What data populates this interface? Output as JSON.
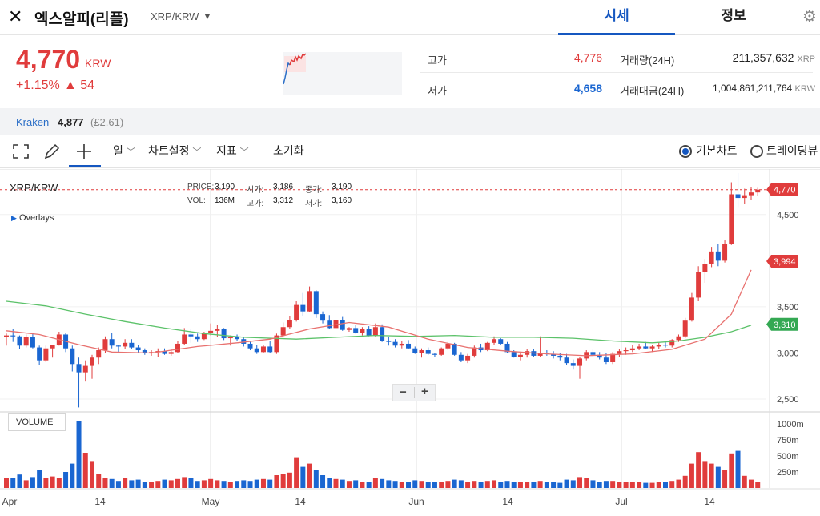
{
  "header": {
    "logo_glyph": "✕",
    "coin_name": "엑스알피(리플)",
    "pair": "XRP/KRW",
    "tabs": [
      {
        "label": "시세"
      },
      {
        "label": "정보"
      }
    ]
  },
  "summary": {
    "price": "4,770",
    "price_unit": "KRW",
    "change_pct": "+1.15%",
    "change_abs": "▲ 54",
    "high_label": "고가",
    "high_value": "4,776",
    "low_label": "저가",
    "low_value": "4,658",
    "volume_label": "거래량(24H)",
    "volume_value": "211,357,632",
    "volume_unit": "XRP",
    "amount_label": "거래대금(24H)",
    "amount_value": "1,004,861,211,764",
    "amount_unit": "KRW"
  },
  "exchange": {
    "name": "Kraken",
    "price": "4,877",
    "change": "(£2.61)"
  },
  "toolbar": {
    "period": "일",
    "chart_settings": "차트설정",
    "indicators": "지표",
    "reset": "초기화",
    "basic_chart": "기본차트",
    "trading_view": "트레이딩뷰"
  },
  "chart_info": {
    "symbol": "XRP/KRW",
    "price_label": "PRICE:",
    "price_value": "3,190",
    "open_label": "시가:",
    "open_value": "3,186",
    "close_label": "종가:",
    "close_value": "3,190",
    "vol_label": "VOL:",
    "vol_value": "136M",
    "high_label": "고가:",
    "high_value": "3,312",
    "low_label": "저가:",
    "low_value": "3,160",
    "overlays": "Overlays",
    "volume_panel": "VOLUME",
    "zoom_out": "−",
    "zoom_in": "+"
  },
  "colors": {
    "up": "#e03c3c",
    "down": "#1a66d1",
    "ma_fast": "#e8716f",
    "ma_slow": "#5cc26a",
    "accent": "#1557c0"
  },
  "chart_data": {
    "type": "candlestick",
    "price_axis": {
      "ticks": [
        "4,500",
        "3,500",
        "3,000",
        "2,500"
      ],
      "tick_values": [
        4500,
        3500,
        3000,
        2500
      ],
      "min": 2370,
      "max": 4950
    },
    "volume_axis": {
      "ticks": [
        "1000m",
        "750m",
        "500m",
        "250m"
      ],
      "tick_values": [
        1000,
        750,
        500,
        250
      ],
      "max": 1100
    },
    "x_ticks": [
      "Apr",
      "14",
      "May",
      "14",
      "Jun",
      "14",
      "Jul",
      "14"
    ],
    "price_markers": [
      {
        "label": "4,770",
        "value": 4770,
        "color": "#e03c3c"
      },
      {
        "label": "3,994",
        "value": 3994,
        "color": "#e03c3c"
      },
      {
        "label": "3,310",
        "value": 3310,
        "color": "#34a853"
      }
    ],
    "candles": [
      [
        3170,
        3210,
        3080,
        3190,
        160
      ],
      [
        3190,
        3260,
        3120,
        3180,
        150
      ],
      [
        3180,
        3190,
        3040,
        3080,
        210
      ],
      [
        3080,
        3200,
        3060,
        3170,
        120
      ],
      [
        3170,
        3210,
        3050,
        3060,
        170
      ],
      [
        3060,
        3080,
        2870,
        2920,
        280
      ],
      [
        2920,
        3080,
        2900,
        3050,
        150
      ],
      [
        3050,
        3090,
        2950,
        3090,
        180
      ],
      [
        3090,
        3230,
        3080,
        3200,
        160
      ],
      [
        3200,
        3220,
        3010,
        3050,
        250
      ],
      [
        3050,
        3080,
        2800,
        2880,
        380
      ],
      [
        2880,
        2950,
        2410,
        2790,
        1050
      ],
      [
        2790,
        2920,
        2690,
        2860,
        550
      ],
      [
        2860,
        2980,
        2720,
        2950,
        420
      ],
      [
        2950,
        3060,
        2880,
        3030,
        220
      ],
      [
        3030,
        3180,
        3000,
        3150,
        160
      ],
      [
        3150,
        3220,
        3050,
        3080,
        140
      ],
      [
        3080,
        3090,
        3000,
        3070,
        110
      ],
      [
        3070,
        3150,
        3040,
        3110,
        150
      ],
      [
        3110,
        3150,
        3040,
        3060,
        120
      ],
      [
        3060,
        3090,
        3000,
        3030,
        130
      ],
      [
        3030,
        3050,
        2980,
        3000,
        100
      ],
      [
        3000,
        3030,
        2970,
        3010,
        90
      ],
      [
        3010,
        3050,
        2960,
        3020,
        110
      ],
      [
        3020,
        3050,
        2980,
        2990,
        130
      ],
      [
        2990,
        3040,
        2970,
        3010,
        120
      ],
      [
        3010,
        3130,
        3000,
        3100,
        140
      ],
      [
        3100,
        3270,
        3090,
        3200,
        170
      ],
      [
        3200,
        3260,
        3110,
        3180,
        150
      ],
      [
        3180,
        3210,
        3120,
        3150,
        110
      ],
      [
        3150,
        3230,
        3140,
        3220,
        120
      ],
      [
        3220,
        3320,
        3190,
        3240,
        140
      ],
      [
        3240,
        3300,
        3170,
        3260,
        120
      ],
      [
        3260,
        3270,
        3140,
        3160,
        110
      ],
      [
        3160,
        3190,
        3080,
        3170,
        100
      ],
      [
        3170,
        3200,
        3130,
        3150,
        110
      ],
      [
        3150,
        3170,
        3070,
        3100,
        120
      ],
      [
        3100,
        3120,
        3030,
        3050,
        110
      ],
      [
        3050,
        3090,
        2990,
        3010,
        130
      ],
      [
        3010,
        3090,
        3000,
        3070,
        140
      ],
      [
        3070,
        3130,
        3000,
        3010,
        130
      ],
      [
        3010,
        3210,
        2990,
        3190,
        200
      ],
      [
        3190,
        3330,
        3180,
        3280,
        220
      ],
      [
        3280,
        3400,
        3260,
        3360,
        240
      ],
      [
        3360,
        3560,
        3340,
        3520,
        480
      ],
      [
        3520,
        3650,
        3400,
        3450,
        330
      ],
      [
        3450,
        3720,
        3440,
        3670,
        380
      ],
      [
        3670,
        3680,
        3380,
        3420,
        280
      ],
      [
        3420,
        3450,
        3320,
        3350,
        200
      ],
      [
        3350,
        3410,
        3260,
        3270,
        160
      ],
      [
        3270,
        3380,
        3260,
        3360,
        140
      ],
      [
        3360,
        3390,
        3240,
        3250,
        130
      ],
      [
        3250,
        3280,
        3230,
        3270,
        110
      ],
      [
        3270,
        3300,
        3210,
        3220,
        120
      ],
      [
        3220,
        3280,
        3190,
        3260,
        100
      ],
      [
        3260,
        3290,
        3180,
        3190,
        90
      ],
      [
        3190,
        3320,
        3170,
        3280,
        150
      ],
      [
        3280,
        3310,
        3120,
        3130,
        140
      ],
      [
        3130,
        3170,
        3080,
        3120,
        120
      ],
      [
        3120,
        3150,
        3060,
        3080,
        110
      ],
      [
        3080,
        3130,
        3050,
        3100,
        100
      ],
      [
        3100,
        3140,
        3040,
        3050,
        90
      ],
      [
        3050,
        3070,
        2990,
        3000,
        120
      ],
      [
        3000,
        3050,
        2950,
        3030,
        110
      ],
      [
        3030,
        3060,
        2980,
        2990,
        100
      ],
      [
        2990,
        3000,
        2960,
        2980,
        90
      ],
      [
        2980,
        3060,
        2970,
        3050,
        100
      ],
      [
        3050,
        3120,
        3030,
        3100,
        110
      ],
      [
        3100,
        3110,
        2970,
        2980,
        130
      ],
      [
        2980,
        3010,
        2900,
        2920,
        120
      ],
      [
        2920,
        2990,
        2890,
        2970,
        100
      ],
      [
        2970,
        3080,
        2950,
        3060,
        110
      ],
      [
        3060,
        3100,
        3010,
        3030,
        100
      ],
      [
        3030,
        3120,
        3020,
        3110,
        110
      ],
      [
        3110,
        3180,
        3090,
        3150,
        120
      ],
      [
        3150,
        3160,
        3090,
        3100,
        100
      ],
      [
        3100,
        3120,
        3000,
        3010,
        110
      ],
      [
        3010,
        3030,
        2950,
        2960,
        100
      ],
      [
        2960,
        3000,
        2920,
        2980,
        90
      ],
      [
        2980,
        3040,
        2950,
        3020,
        100
      ],
      [
        3020,
        3040,
        2960,
        2970,
        100
      ],
      [
        2970,
        3180,
        2960,
        3000,
        110
      ],
      [
        3000,
        3030,
        2970,
        2990,
        100
      ],
      [
        2990,
        3020,
        2940,
        2970,
        90
      ],
      [
        2970,
        3000,
        2920,
        2950,
        80
      ],
      [
        2950,
        2990,
        2870,
        2890,
        130
      ],
      [
        2890,
        2930,
        2820,
        2860,
        120
      ],
      [
        2860,
        2960,
        2720,
        2940,
        170
      ],
      [
        2940,
        3030,
        2920,
        3010,
        160
      ],
      [
        3010,
        3040,
        2960,
        2980,
        120
      ],
      [
        2980,
        3010,
        2930,
        2950,
        100
      ],
      [
        2950,
        3000,
        2880,
        2900,
        110
      ],
      [
        2900,
        3010,
        2880,
        2990,
        110
      ],
      [
        2990,
        3040,
        2960,
        3020,
        100
      ],
      [
        3020,
        3060,
        2980,
        3030,
        90
      ],
      [
        3030,
        3090,
        3010,
        3050,
        100
      ],
      [
        3050,
        3100,
        3030,
        3070,
        90
      ],
      [
        3070,
        3120,
        3040,
        3050,
        80
      ],
      [
        3050,
        3090,
        3010,
        3070,
        80
      ],
      [
        3070,
        3110,
        3040,
        3090,
        90
      ],
      [
        3090,
        3130,
        3060,
        3080,
        90
      ],
      [
        3080,
        3150,
        3060,
        3140,
        110
      ],
      [
        3140,
        3200,
        3120,
        3180,
        130
      ],
      [
        3180,
        3380,
        3160,
        3350,
        190
      ],
      [
        3350,
        3650,
        3340,
        3600,
        380
      ],
      [
        3600,
        3940,
        3560,
        3880,
        560
      ],
      [
        3880,
        4020,
        3760,
        3960,
        420
      ],
      [
        3960,
        4150,
        3930,
        4100,
        380
      ],
      [
        4100,
        4180,
        3940,
        4000,
        330
      ],
      [
        4000,
        4220,
        3980,
        4180,
        280
      ],
      [
        4180,
        4850,
        4170,
        4720,
        540
      ],
      [
        4720,
        4950,
        4580,
        4680,
        580
      ],
      [
        4680,
        4780,
        4620,
        4710,
        190
      ],
      [
        4710,
        4800,
        4660,
        4740,
        130
      ],
      [
        4740,
        4790,
        4700,
        4770,
        90
      ]
    ],
    "ma_fast": [
      [
        0,
        3240
      ],
      [
        5,
        3200
      ],
      [
        11,
        3090
      ],
      [
        16,
        3010
      ],
      [
        22,
        3000
      ],
      [
        29,
        3070
      ],
      [
        35,
        3110
      ],
      [
        40,
        3150
      ],
      [
        46,
        3260
      ],
      [
        52,
        3330
      ],
      [
        58,
        3280
      ],
      [
        64,
        3150
      ],
      [
        70,
        3060
      ],
      [
        76,
        3020
      ],
      [
        82,
        2990
      ],
      [
        88,
        2970
      ],
      [
        95,
        2990
      ],
      [
        101,
        3040
      ],
      [
        106,
        3150
      ],
      [
        110,
        3420
      ],
      [
        113,
        3900
      ]
    ],
    "ma_slow": [
      [
        0,
        3560
      ],
      [
        6,
        3510
      ],
      [
        12,
        3420
      ],
      [
        18,
        3340
      ],
      [
        24,
        3270
      ],
      [
        30,
        3210
      ],
      [
        36,
        3170
      ],
      [
        44,
        3150
      ],
      [
        50,
        3170
      ],
      [
        56,
        3190
      ],
      [
        62,
        3180
      ],
      [
        68,
        3190
      ],
      [
        74,
        3170
      ],
      [
        80,
        3170
      ],
      [
        86,
        3160
      ],
      [
        92,
        3130
      ],
      [
        98,
        3110
      ],
      [
        102,
        3130
      ],
      [
        106,
        3170
      ],
      [
        110,
        3230
      ],
      [
        113,
        3300
      ]
    ]
  }
}
